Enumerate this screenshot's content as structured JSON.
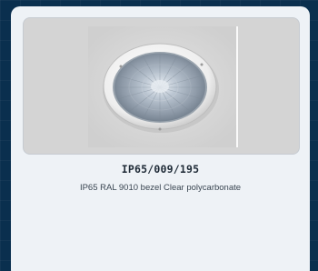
{
  "product": {
    "title": "IP65/009/195",
    "description": "IP65 RAL 9010 bezel Clear polycarbonate",
    "image_icon": "recessed-downlight-photo"
  },
  "colors": {
    "page_background": "#0a2f4e",
    "card_background": "#eef2f6",
    "image_frame_background": "#d4d4d4",
    "title_text": "#1e2a36",
    "description_text": "#3a4652"
  }
}
